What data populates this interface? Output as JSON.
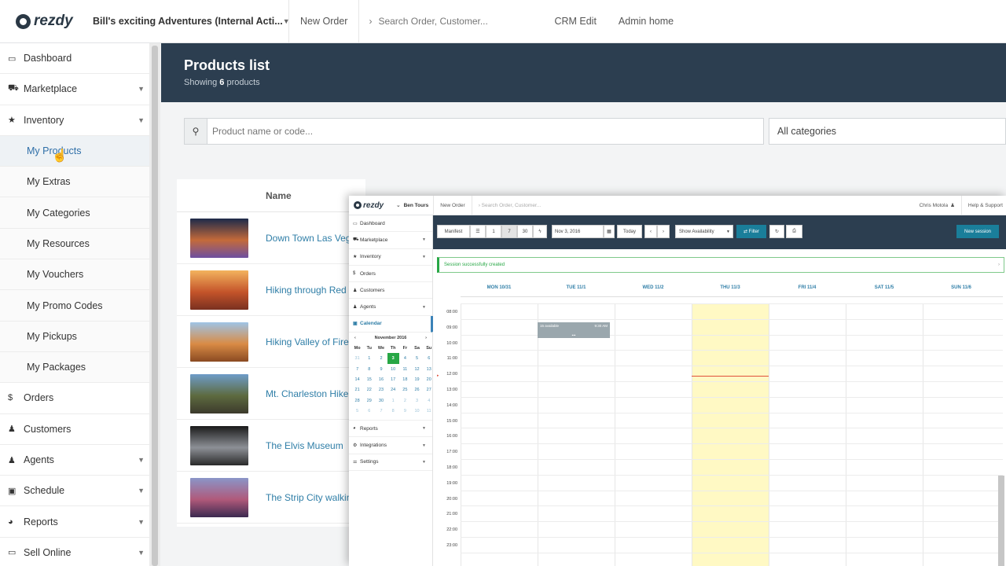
{
  "app": {
    "logo_text": "rezdy",
    "account_name": "Bill's exciting Adventures (Internal Acti...",
    "new_order": "New Order",
    "search_placeholder": "Search Order, Customer...",
    "nav": [
      "CRM Edit",
      "Admin home"
    ]
  },
  "sidebar": {
    "items": [
      {
        "label": "Dashboard",
        "icon": "monitor-icon",
        "glyph": "▭"
      },
      {
        "label": "Marketplace",
        "icon": "cart-icon",
        "glyph": "⛟",
        "chevron": true
      },
      {
        "label": "Inventory",
        "icon": "star-icon",
        "glyph": "★",
        "chevron": true
      },
      {
        "label": "My Products",
        "sub": true,
        "active": true
      },
      {
        "label": "My Extras",
        "sub": true
      },
      {
        "label": "My Categories",
        "sub": true
      },
      {
        "label": "My Resources",
        "sub": true
      },
      {
        "label": "My Vouchers",
        "sub": true
      },
      {
        "label": "My Promo Codes",
        "sub": true
      },
      {
        "label": "My Pickups",
        "sub": true
      },
      {
        "label": "My Packages",
        "sub": true
      },
      {
        "label": "Orders",
        "icon": "dollar-icon",
        "glyph": "$"
      },
      {
        "label": "Customers",
        "icon": "person-icon",
        "glyph": "♟"
      },
      {
        "label": "Agents",
        "icon": "agent-icon",
        "glyph": "♟",
        "chevron": true
      },
      {
        "label": "Schedule",
        "icon": "calendar-icon",
        "glyph": "▣",
        "chevron": true
      },
      {
        "label": "Reports",
        "icon": "pie-chart-icon",
        "glyph": "◕",
        "chevron": true
      },
      {
        "label": "Sell Online",
        "icon": "laptop-icon",
        "glyph": "▭",
        "chevron": true
      }
    ]
  },
  "page": {
    "title": "Products list",
    "subtitle_prefix": "Showing ",
    "subtitle_count": "6",
    "subtitle_suffix": " products",
    "search_placeholder": "Product name or code...",
    "category_select": "All categories"
  },
  "products": {
    "column_name": "Name",
    "rows": [
      {
        "name": "Down Town Las Vegas",
        "thumb": [
          "#1d2a4a",
          "#c46a3a",
          "#6d4fa0"
        ]
      },
      {
        "name": "Hiking through Red Rock",
        "thumb": [
          "#f3b35e",
          "#c4542a",
          "#7a3020"
        ]
      },
      {
        "name": "Hiking Valley of Fire",
        "thumb": [
          "#9fc4e6",
          "#d98b45",
          "#8a4a22"
        ]
      },
      {
        "name": "Mt. Charleston Hike - Cathedral Rock",
        "thumb": [
          "#6e9cc9",
          "#5d6a3f",
          "#3c3a2c"
        ]
      },
      {
        "name": "The Elvis Museum",
        "thumb": [
          "#1a1a1a",
          "#8d9096",
          "#2a2a2a"
        ]
      },
      {
        "name": "The Strip City walking tour",
        "thumb": [
          "#8a95c8",
          "#b0597a",
          "#3b2a50"
        ]
      }
    ]
  },
  "overlay": {
    "logo_text": "rezdy",
    "account": "Ben Tours",
    "new_order": "New Order",
    "search_placeholder": "Search Order, Customer...",
    "user": "Chris Motola",
    "help": "Help & Support",
    "sidebar_top": [
      {
        "label": "Dashboard",
        "glyph": "▭"
      },
      {
        "label": "Marketplace",
        "glyph": "⛟",
        "chevron": true
      },
      {
        "label": "Inventory",
        "glyph": "★",
        "chevron": true
      },
      {
        "label": "Orders",
        "glyph": "$"
      },
      {
        "label": "Customers",
        "glyph": "♟"
      },
      {
        "label": "Agents",
        "glyph": "♟",
        "chevron": true
      },
      {
        "label": "Calendar",
        "glyph": "▣",
        "active": true
      }
    ],
    "sidebar_bottom": [
      {
        "label": "Reports",
        "glyph": "◕",
        "chevron": true
      },
      {
        "label": "Integrations",
        "glyph": "⚙",
        "chevron": true
      },
      {
        "label": "Settings",
        "glyph": "⚌",
        "chevron": true
      }
    ],
    "mini_calendar": {
      "month": "November 2016",
      "prev": "‹",
      "next": "›",
      "dow": [
        "Mo",
        "Tu",
        "We",
        "Th",
        "Fr",
        "Sa",
        "Su"
      ],
      "days": [
        "31",
        "1",
        "2",
        "3",
        "4",
        "5",
        "6",
        "7",
        "8",
        "9",
        "10",
        "11",
        "12",
        "13",
        "14",
        "15",
        "16",
        "17",
        "18",
        "19",
        "20",
        "21",
        "22",
        "23",
        "24",
        "25",
        "26",
        "27",
        "28",
        "29",
        "30",
        "1",
        "2",
        "3",
        "4",
        "5",
        "6",
        "7",
        "8",
        "9",
        "10",
        "11"
      ],
      "muted": [
        0,
        31,
        32,
        33,
        34,
        35,
        36,
        37,
        38,
        39,
        40,
        41
      ],
      "today_index": 3
    },
    "toolbar": {
      "manifest": "Manifest",
      "list_icon": "☰",
      "view_1": "1",
      "view_7": "7",
      "view_30": "30",
      "flash_icon": "ϟ",
      "date": "Nov 3, 2016",
      "cal_icon": "▦",
      "today": "Today",
      "prev": "‹",
      "next": "›",
      "availability": "Show Availability",
      "filter": "⇄ Filter",
      "refresh_icon": "↻",
      "print_icon": "⎙",
      "new_session": "New session"
    },
    "alert": "Session successfully created",
    "alert_close": "›",
    "week_days": [
      "MON 10/31",
      "TUE 11/1",
      "WED 11/2",
      "THU 11/3",
      "FRI 11/4",
      "SAT 11/5",
      "SUN 11/6"
    ],
    "times": [
      "08:00",
      "09:00",
      "10:00",
      "11:00",
      "12:00",
      "13:00",
      "14:00",
      "15:00",
      "16:00",
      "17:00",
      "18:00",
      "19:00",
      "20:00",
      "21:00",
      "22:00",
      "23:00"
    ],
    "event": {
      "left": "15 available",
      "right": "9:30 AM",
      "dots": "•••"
    }
  }
}
